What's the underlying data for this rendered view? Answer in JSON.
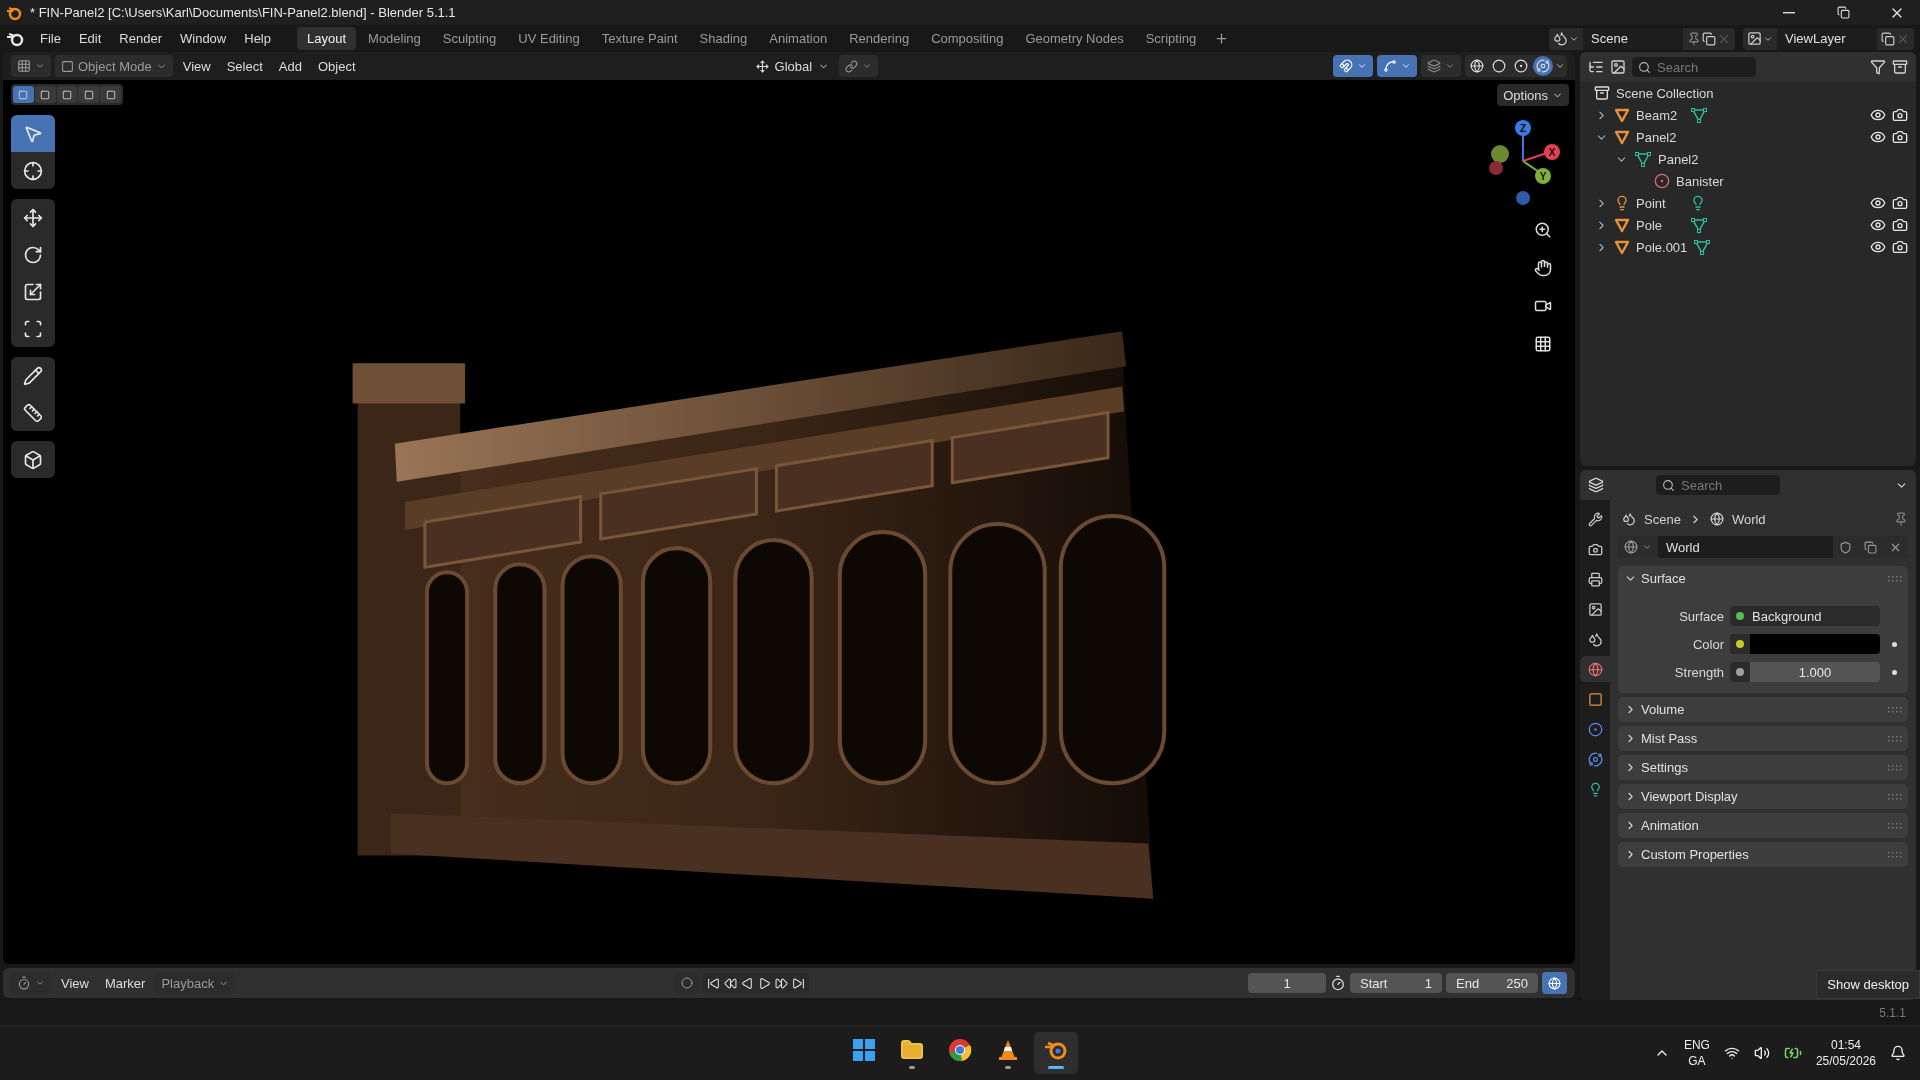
{
  "window": {
    "title": "* FIN-Panel2 [C:\\Users\\Karl\\Documents\\FIN-Panel2.blend] - Blender 5.1.1"
  },
  "menu": [
    "File",
    "Edit",
    "Render",
    "Window",
    "Help"
  ],
  "workspaces": [
    {
      "label": "Layout",
      "selected": true
    },
    {
      "label": "Modeling",
      "selected": false
    },
    {
      "label": "Sculpting",
      "selected": false
    },
    {
      "label": "UV Editing",
      "selected": false
    },
    {
      "label": "Texture Paint",
      "selected": false
    },
    {
      "label": "Shading",
      "selected": false
    },
    {
      "label": "Animation",
      "selected": false
    },
    {
      "label": "Rendering",
      "selected": false
    },
    {
      "label": "Compositing",
      "selected": false
    },
    {
      "label": "Geometry Nodes",
      "selected": false
    },
    {
      "label": "Scripting",
      "selected": false
    }
  ],
  "scene": {
    "value": "Scene"
  },
  "view_layer": {
    "value": "ViewLayer"
  },
  "viewport": {
    "mode": "Object Mode",
    "menus": [
      "View",
      "Select",
      "Add",
      "Object"
    ],
    "orientation": "Global",
    "options": "Options",
    "toggles": [
      {
        "kind": "snap",
        "on": true
      },
      {
        "kind": "gizmo",
        "on": true
      },
      {
        "kind": "xray",
        "on": false
      }
    ],
    "shading_modes": [
      {
        "kind": "wireframe",
        "selected": false
      },
      {
        "kind": "solid",
        "selected": false
      },
      {
        "kind": "material",
        "selected": false
      },
      {
        "kind": "rendered",
        "selected": true
      }
    ],
    "select_modes": [
      {
        "selected": true
      },
      {
        "selected": false
      },
      {
        "selected": false
      },
      {
        "selected": false
      },
      {
        "selected": false
      }
    ],
    "tool_groups": [
      [
        {
          "kind": "select",
          "selected": true
        },
        {
          "kind": "cursor",
          "selected": false
        }
      ],
      [
        {
          "kind": "move",
          "selected": false
        },
        {
          "kind": "rotate",
          "selected": false
        },
        {
          "kind": "scale",
          "selected": false
        },
        {
          "kind": "transform",
          "selected": false
        }
      ],
      [
        {
          "kind": "annotate",
          "selected": false
        },
        {
          "kind": "measure",
          "selected": false
        }
      ],
      [
        {
          "kind": "add_cube",
          "selected": false
        }
      ]
    ],
    "axes": [
      {
        "label": "Z"
      },
      {
        "label": "X"
      },
      {
        "label": "Y"
      }
    ]
  },
  "outliner": {
    "search": {
      "placeholder": "Search"
    },
    "root": "Scene Collection",
    "items": [
      {
        "name": "Beam2",
        "kind": "mesh_object",
        "expanded": false,
        "data_badge": true
      },
      {
        "name": "Panel2",
        "kind": "mesh_object",
        "expanded": true,
        "data_badge": false,
        "children": [
          {
            "name": "Panel2",
            "kind": "mesh_data",
            "expanded": true,
            "children": [
              {
                "name": "Banister",
                "kind": "material"
              }
            ]
          }
        ]
      },
      {
        "name": "Point",
        "kind": "light_object",
        "expanded": false,
        "data_badge": true
      },
      {
        "name": "Pole",
        "kind": "mesh_object",
        "expanded": false,
        "data_badge": true
      },
      {
        "name": "Pole.001",
        "kind": "mesh_object",
        "expanded": false,
        "data_badge": true
      }
    ]
  },
  "properties": {
    "search": {
      "placeholder": "Search"
    },
    "tabs": [
      {
        "kind": "tool",
        "selected": false
      },
      {
        "kind": "render",
        "selected": false
      },
      {
        "kind": "output",
        "selected": false
      },
      {
        "kind": "view_layer",
        "selected": false
      },
      {
        "kind": "scene",
        "selected": false
      },
      {
        "kind": "world",
        "selected": true
      },
      {
        "kind": "object",
        "selected": false
      },
      {
        "kind": "physics",
        "selected": false
      },
      {
        "kind": "constraints",
        "selected": false
      },
      {
        "kind": "data",
        "selected": false
      }
    ],
    "breadcrumb": [
      "Scene",
      "World"
    ],
    "datablock": "World",
    "panels": [
      {
        "title": "Surface",
        "expanded": true,
        "fields": [
          {
            "label": "Surface",
            "kind": "shader",
            "value": "Background",
            "color": "#4fc14f"
          },
          {
            "label": "Color",
            "kind": "color",
            "color": "#c8c82a"
          },
          {
            "label": "Strength",
            "kind": "number",
            "value": "1.000",
            "color": "#a0a0a0"
          }
        ]
      },
      {
        "title": "Volume",
        "expanded": false
      },
      {
        "title": "Mist Pass",
        "expanded": false
      },
      {
        "title": "Settings",
        "expanded": false
      },
      {
        "title": "Viewport Display",
        "expanded": false
      },
      {
        "title": "Animation",
        "expanded": false
      },
      {
        "title": "Custom Properties",
        "expanded": false
      }
    ]
  },
  "timeline": {
    "menus": [
      "View",
      "Marker"
    ],
    "playback": "Playback",
    "current_frame": "1",
    "start_label": "Start",
    "start": "1",
    "end_label": "End",
    "end": "250"
  },
  "status": {
    "version": "5.1.1"
  },
  "tooltip": {
    "text": "Show desktop"
  },
  "taskbar": {
    "apps": [
      {
        "kind": "start",
        "running": false,
        "selected": false
      },
      {
        "kind": "files",
        "running": true,
        "selected": false
      },
      {
        "kind": "browser",
        "running": false,
        "selected": false
      },
      {
        "kind": "cone",
        "running": true,
        "selected": false
      },
      {
        "kind": "blender",
        "running": true,
        "selected": true
      }
    ],
    "language": "ENG",
    "layout": "GA",
    "time": "01:54",
    "date": "25/05/2026"
  }
}
